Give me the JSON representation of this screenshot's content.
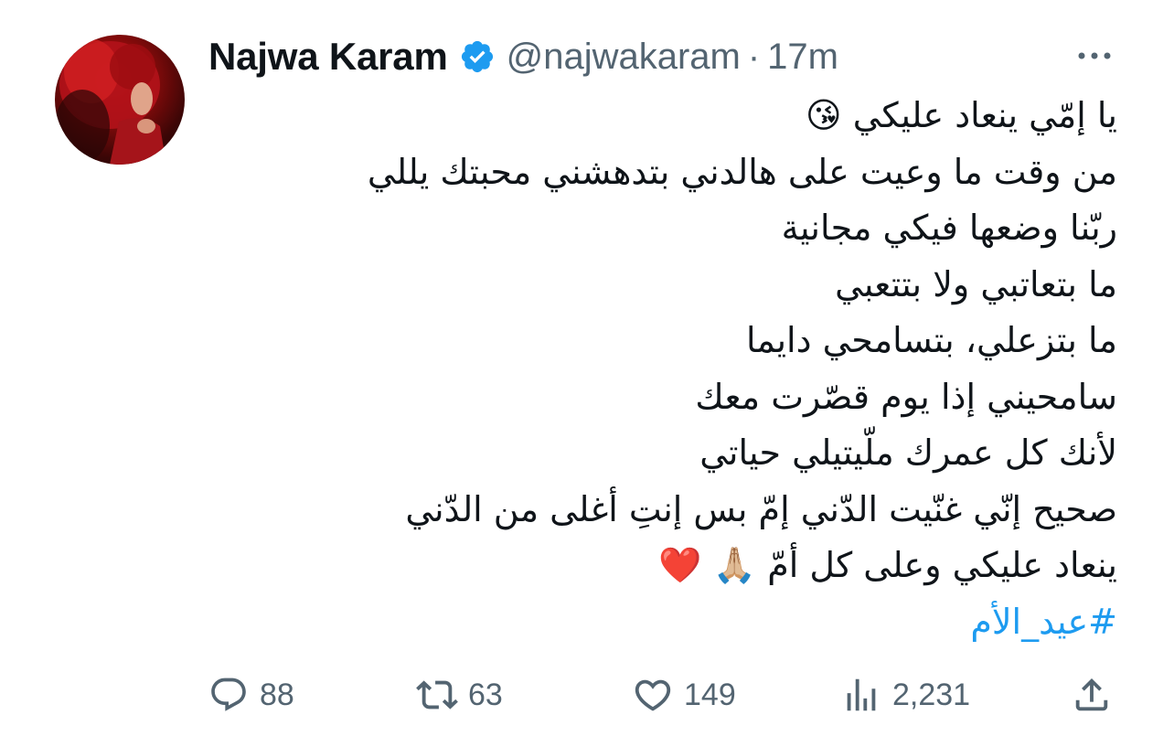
{
  "author": {
    "name": "Najwa Karam",
    "handle": "@najwakaram",
    "separator": "·",
    "time": "17m",
    "verified": true
  },
  "tweet": {
    "lines": [
      "يا إمّي ينعاد عليكي",
      "من وقت ما وعيت على هالدني بتدهشني محبتك يللي",
      "ربّنا وضعها فيكي مجانية",
      "ما بتعاتبي ولا بتتعبي",
      "ما بتزعلي، بتسامحي دايما",
      "سامحيني إذا يوم قصّرت معك",
      "لأنك كل عمرك ملّيتيلي حياتي",
      "صحيح إنّي غنّيت الدّني إمّ بس إنتِ أغلى من الدّني",
      "ينعاد عليكي وعلى كل أمّ"
    ],
    "emoji_kiss": "😘",
    "emoji_pray": "🙏🏼",
    "emoji_heart": "❤️",
    "hashtag": "#عيد_الأم"
  },
  "actions": {
    "replies": "88",
    "retweets": "63",
    "likes": "149",
    "views": "2,231"
  },
  "colors": {
    "text": "#0f1419",
    "secondary": "#536471",
    "accent": "#1d9bf0"
  },
  "icons": [
    "verified-badge-icon",
    "more-icon",
    "reply-icon",
    "retweet-icon",
    "like-icon",
    "views-icon",
    "share-icon"
  ]
}
